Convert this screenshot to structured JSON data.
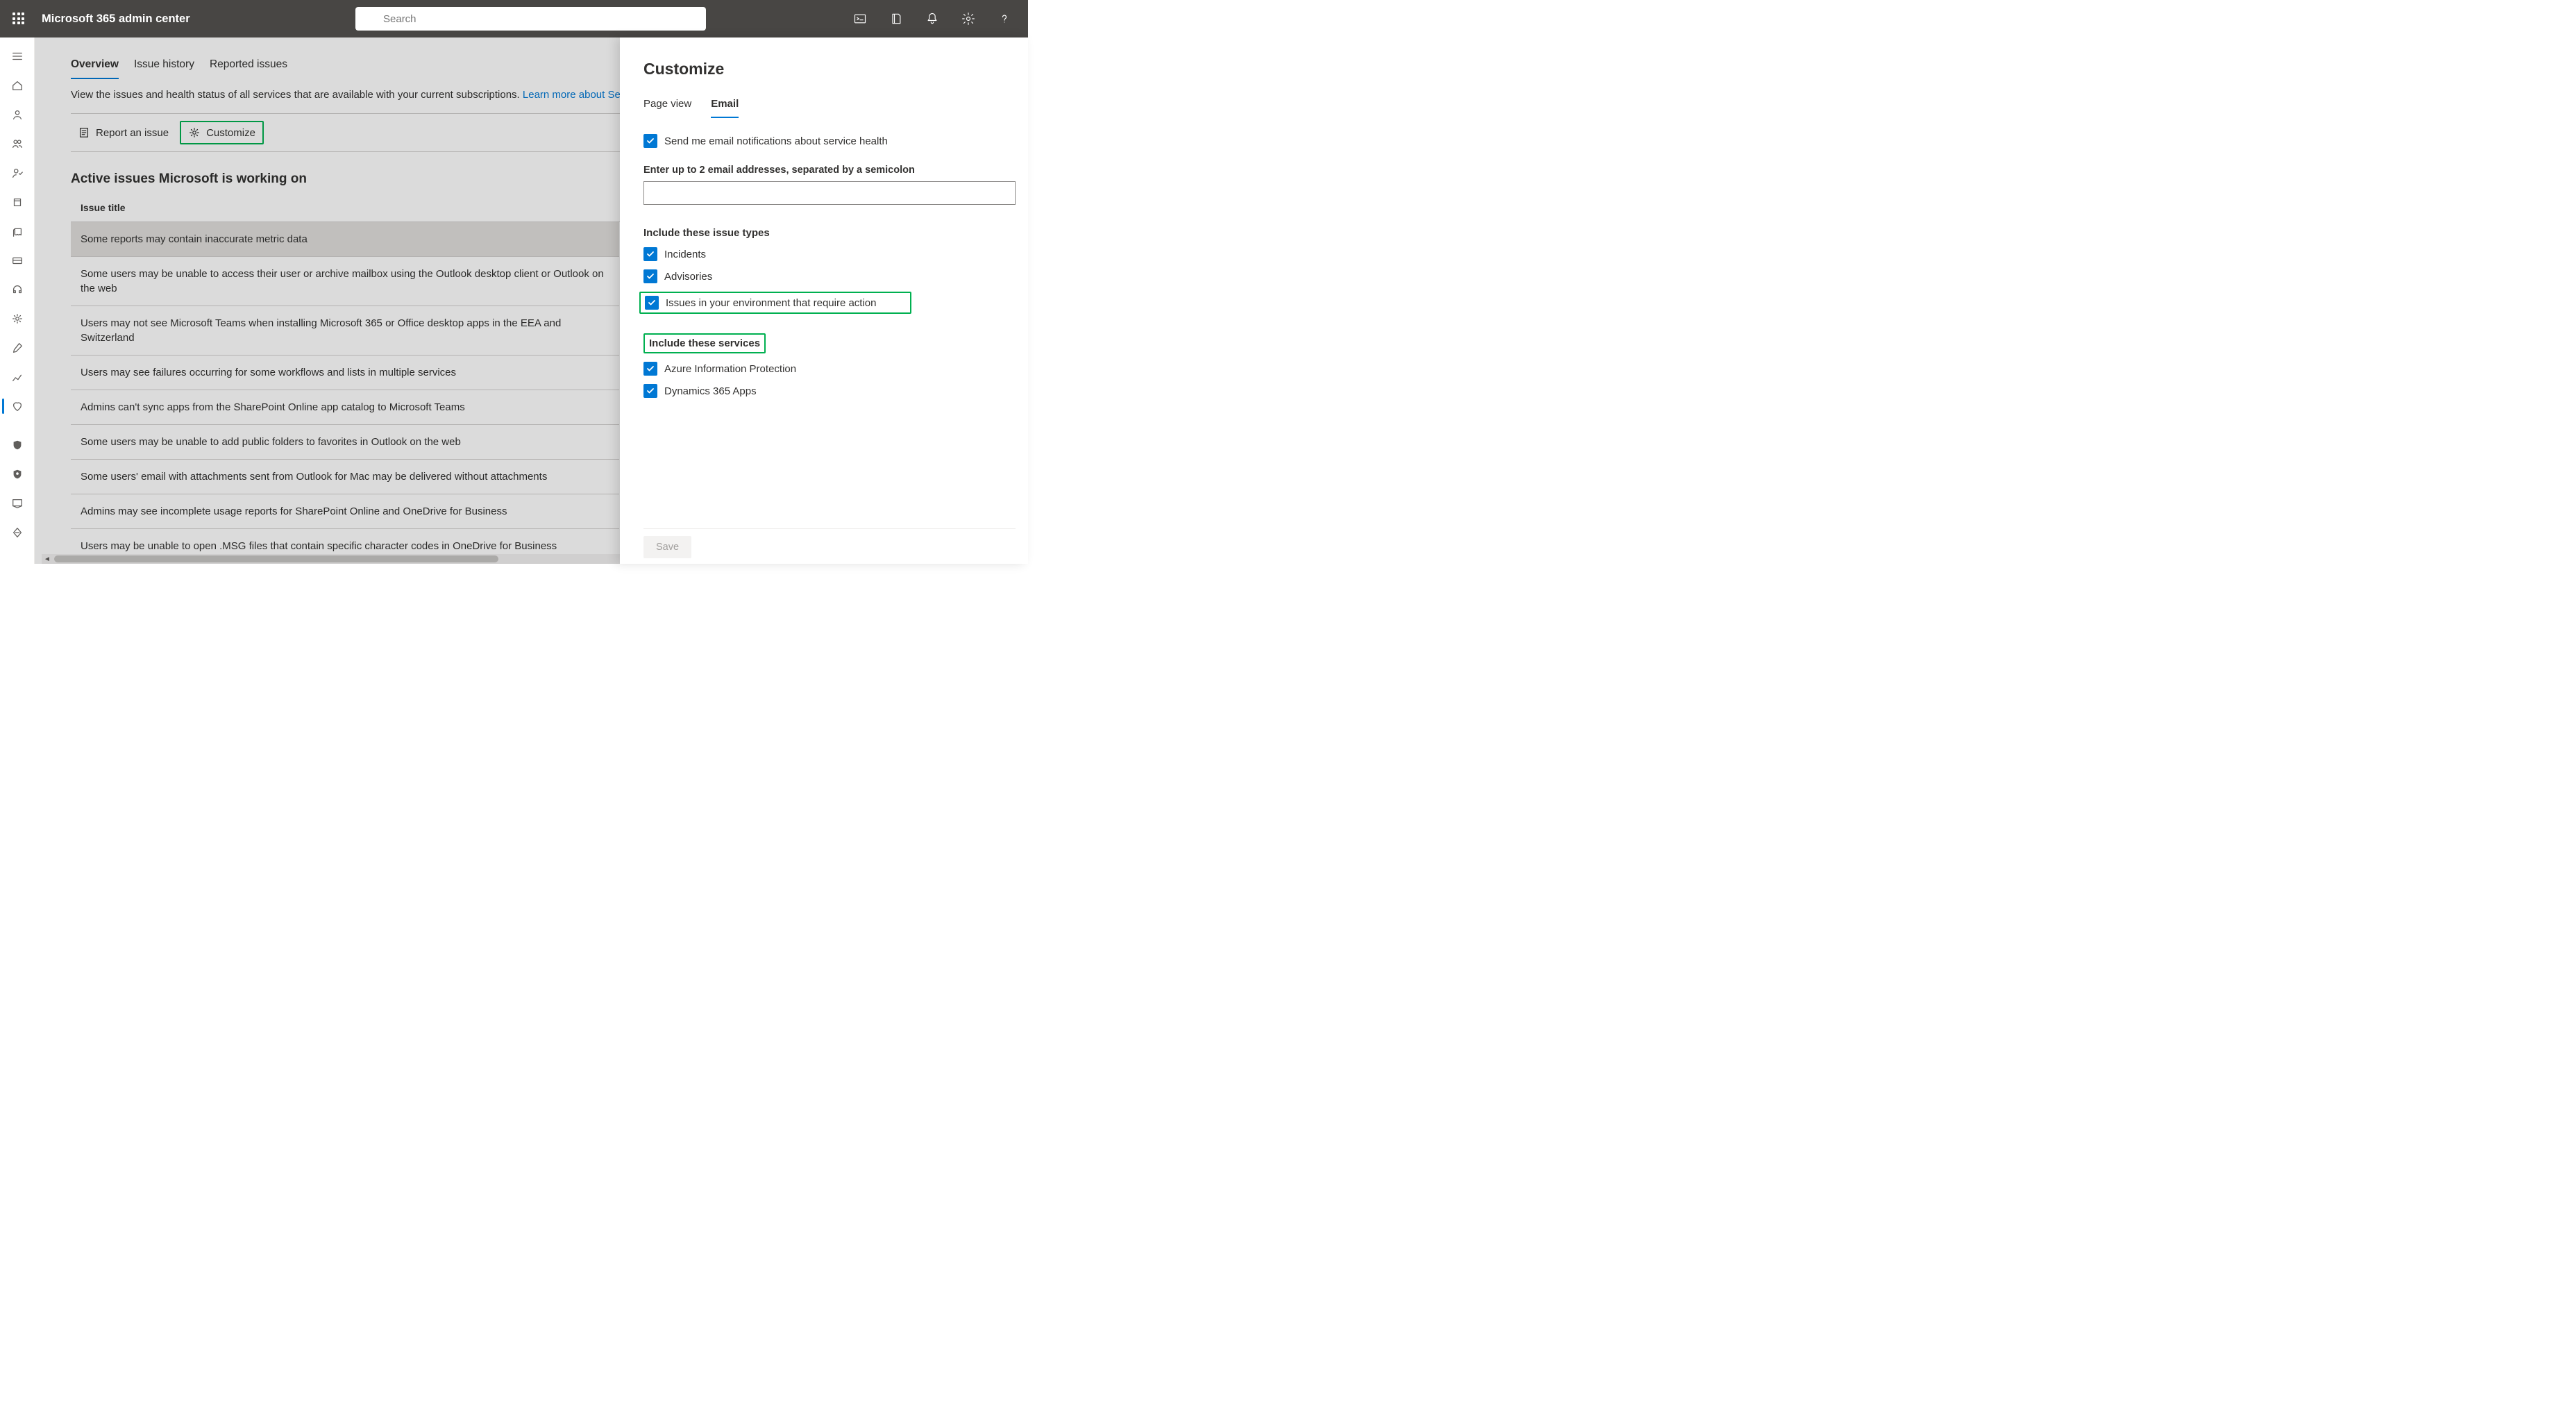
{
  "header": {
    "title": "Microsoft 365 admin center",
    "search_placeholder": "Search"
  },
  "tabs": {
    "overview": "Overview",
    "issue_history": "Issue history",
    "reported_issues": "Reported issues"
  },
  "subtitle": {
    "text": "View the issues and health status of all services that are available with your current subscriptions. ",
    "link": "Learn more about Ser"
  },
  "toolbar": {
    "report": "Report an issue",
    "customize": "Customize"
  },
  "section_title": "Active issues Microsoft is working on",
  "table": {
    "col_title": "Issue title"
  },
  "issues": [
    "Some reports may contain inaccurate metric data",
    "Some users may be unable to access their user or archive mailbox using the Outlook desktop client or Outlook on the web",
    "Users may not see Microsoft Teams when installing Microsoft 365 or Office desktop apps in the EEA and Switzerland",
    "Users may see failures occurring for some workflows and lists in multiple services",
    "Admins can't sync apps from the SharePoint Online app catalog to Microsoft Teams",
    "Some users may be unable to add public folders to favorites in Outlook on the web",
    "Some users' email with attachments sent from Outlook for Mac may be delivered without attachments",
    "Admins may see incomplete usage reports for SharePoint Online and OneDrive for Business",
    "Users may be unable to open .MSG files that contain specific character codes in OneDrive for Business"
  ],
  "panel": {
    "title": "Customize",
    "tab_page_view": "Page view",
    "tab_email": "Email",
    "notify_label": "Send me email notifications about service health",
    "email_field_label": "Enter up to 2 email addresses, separated by a semicolon",
    "issue_types_label": "Include these issue types",
    "issue_types": {
      "incidents": "Incidents",
      "advisories": "Advisories",
      "env_action": "Issues in your environment that require action"
    },
    "services_label": "Include these services",
    "services": {
      "aip": "Azure Information Protection",
      "d365": "Dynamics 365 Apps"
    },
    "save": "Save"
  }
}
